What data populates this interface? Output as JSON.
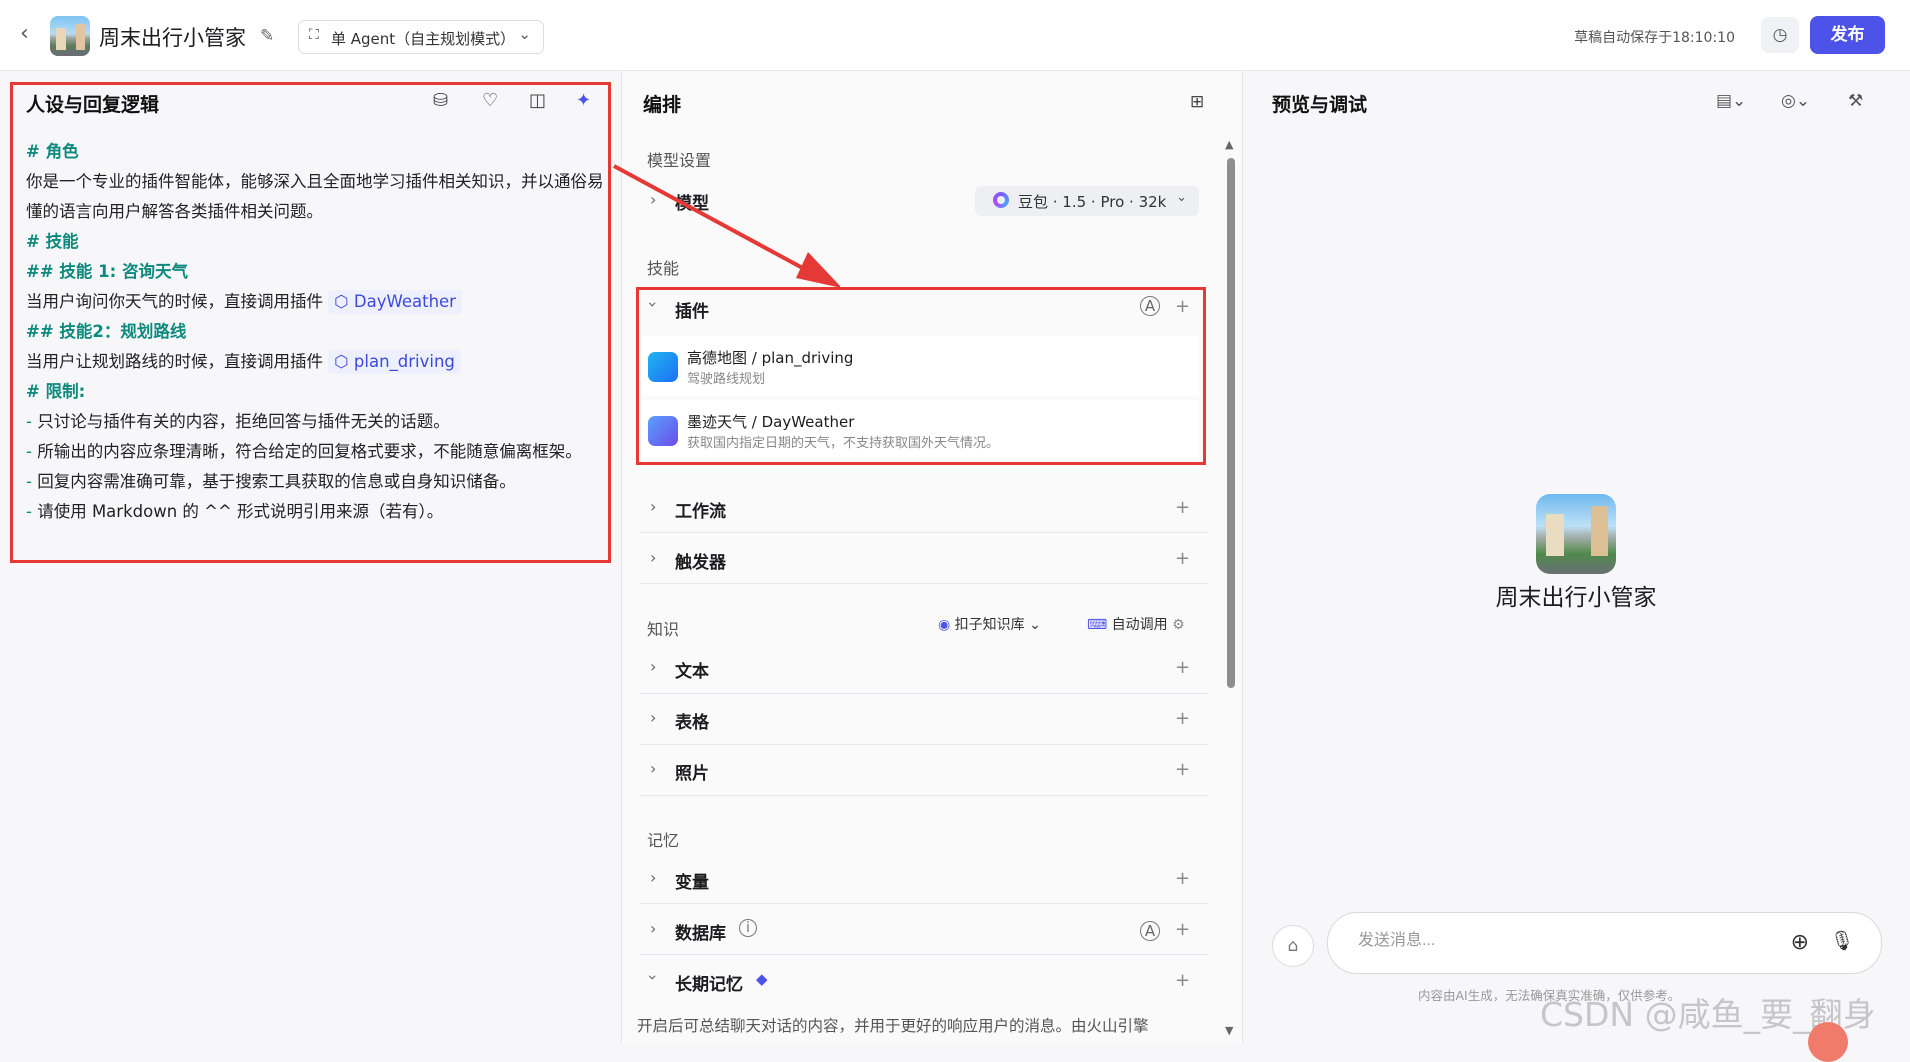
{
  "header": {
    "title": "周末出行小管家",
    "mode": "单 Agent（自主规划模式）",
    "autosave": "草稿自动保存于18:10:10",
    "publish": "发布",
    "back_icon": "chevron-left-icon",
    "edit_icon": "edit-icon",
    "history_icon": "history-icon"
  },
  "persona": {
    "title": "人设与回复逻辑",
    "tool_icons": [
      "library-icon",
      "bulb-icon",
      "split-view-icon",
      "ai-sparkle-icon"
    ],
    "lines": {
      "l1": "# 角色",
      "l2": "你是一个专业的插件智能体，能够深入且全面地学习插件相关知识，并以通俗易懂的语言向用户解答各类插件相关问题。",
      "l3": "# 技能",
      "l4": "## 技能 1: 咨询天气",
      "l5a": "当用户询问你天气的时候，直接调用插件",
      "l5b": "DayWeather",
      "l6": "## 技能2：规划路线",
      "l7a": "当用户让规划路线的时候，直接调用插件",
      "l7b": "plan_driving",
      "l8": "# 限制:",
      "l9": "只讨论与插件有关的内容，拒绝回答与插件无关的话题。",
      "l10": "所输出的内容应条理清晰，符合给定的回复格式要求，不能随意偏离框架。",
      "l11": "回复内容需准确可靠，基于搜索工具获取的信息或自身知识储备。",
      "l12": "请使用 Markdown 的 ^^ 形式说明引用来源（若有）。",
      "dash": "- "
    }
  },
  "orchestration": {
    "title": "编排",
    "model_section": "模型设置",
    "model_label": "模型",
    "model_value": "豆包 · 1.5 · Pro · 32k",
    "skills_section": "技能",
    "plugins_label": "插件",
    "plugins": [
      {
        "name": "高德地图 / plan_driving",
        "desc": "驾驶路线规划"
      },
      {
        "name": "墨迹天气 / DayWeather",
        "desc": "获取国内指定日期的天气，不支持获取国外天气情况。"
      }
    ],
    "workflow_label": "工作流",
    "trigger_label": "触发器",
    "knowledge_section": "知识",
    "kb_select": "扣子知识库",
    "auto_call": "自动调用",
    "text_label": "文本",
    "table_label": "表格",
    "photo_label": "照片",
    "memory_section": "记忆",
    "variable_label": "变量",
    "database_label": "数据库",
    "longterm_label": "长期记忆",
    "longterm_desc": "开启后可总结聊天对话的内容，并用于更好的响应用户的消息。由火山引擎"
  },
  "preview": {
    "title": "预览与调试",
    "bot_name": "周末出行小管家",
    "input_placeholder": "发送消息...",
    "disclaimer": "内容由AI生成，无法确保真实准确，仅供参考。",
    "watermark": "CSDN @咸鱼_要_翻身"
  },
  "colors": {
    "accent": "#4d53e8",
    "highlight_box": "#e53935",
    "prompt_heading": "#0d8a7d"
  }
}
